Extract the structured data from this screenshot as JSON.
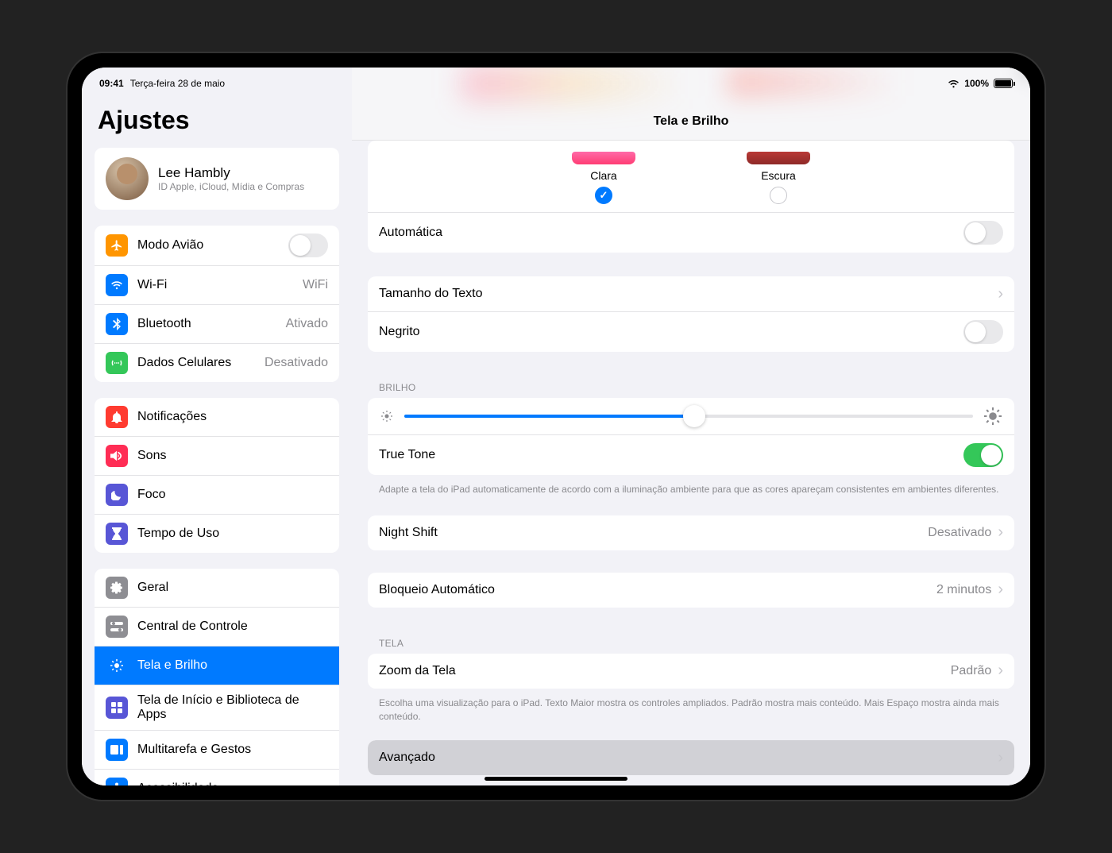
{
  "status": {
    "time": "09:41",
    "date": "Terça-feira 28 de maio",
    "battery": "100%"
  },
  "sidebar": {
    "title": "Ajustes",
    "profile": {
      "name": "Lee Hambly",
      "sub": "ID Apple, iCloud, Mídia e Compras"
    },
    "group1": {
      "airplane": "Modo Avião",
      "wifi": "Wi-Fi",
      "wifi_value": "WiFi",
      "bluetooth": "Bluetooth",
      "bluetooth_value": "Ativado",
      "cellular": "Dados Celulares",
      "cellular_value": "Desativado"
    },
    "group2": {
      "notifications": "Notificações",
      "sounds": "Sons",
      "focus": "Foco",
      "screentime": "Tempo de Uso"
    },
    "group3": {
      "general": "Geral",
      "controlcenter": "Central de Controle",
      "display": "Tela e Brilho",
      "homescreen": "Tela de Início e Biblioteca de Apps",
      "multitask": "Multitarefa e Gestos",
      "accessibility": "Acessibilidade"
    }
  },
  "main": {
    "title": "Tela e Brilho",
    "appearance": {
      "light": "Clara",
      "dark": "Escura"
    },
    "automatic": "Automática",
    "textsize": "Tamanho do Texto",
    "bold": "Negrito",
    "brightness_header": "BRILHO",
    "truetone": "True Tone",
    "truetone_footer": "Adapte a tela do iPad automaticamente de acordo com a iluminação ambiente para que as cores apareçam consistentes em ambientes diferentes.",
    "nightshift": "Night Shift",
    "nightshift_value": "Desativado",
    "autolock": "Bloqueio Automático",
    "autolock_value": "2 minutos",
    "tela_header": "TELA",
    "zoom": "Zoom da Tela",
    "zoom_value": "Padrão",
    "zoom_footer": "Escolha uma visualização para o iPad. Texto Maior mostra os controles ampliados. Padrão mostra mais conteúdo. Mais Espaço mostra ainda mais conteúdo.",
    "advanced": "Avançado"
  },
  "colors": {
    "orange": "#ff9500",
    "blue": "#007aff",
    "green": "#34c759",
    "red": "#ff3b30",
    "pink": "#ff2d55",
    "purple": "#5856d6",
    "gray": "#8e8e93",
    "indigo": "#5856d6"
  }
}
